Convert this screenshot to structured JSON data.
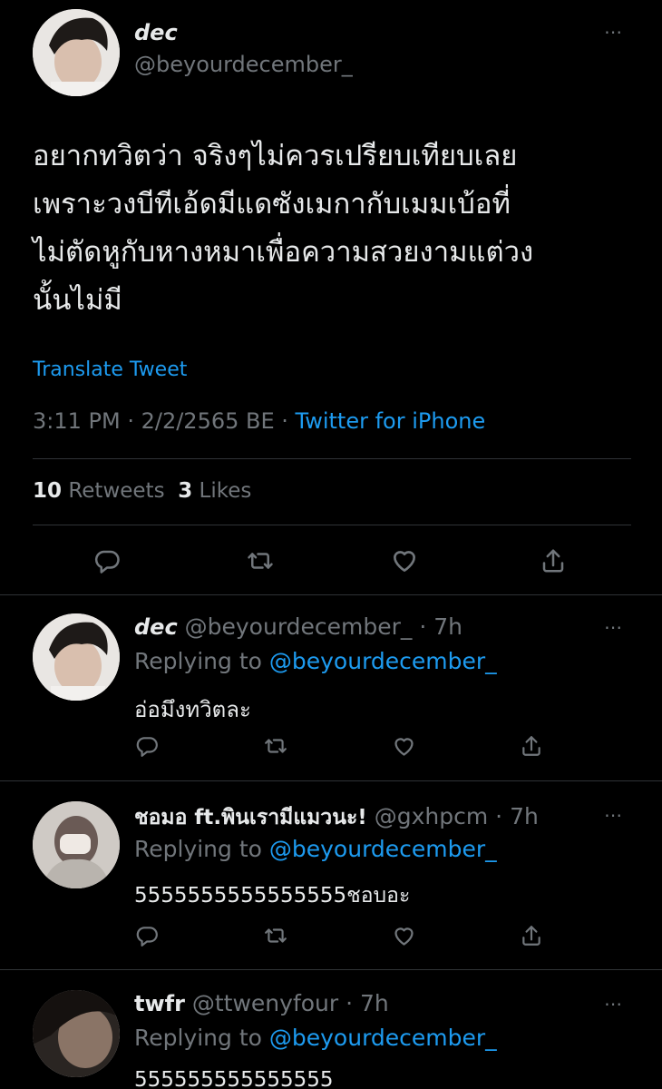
{
  "main_tweet": {
    "display_name": "dec",
    "handle": "@beyourdecember_",
    "more_icon": "⋯",
    "text_lines": [
      "อยากทวิตว่า จริงๆไม่ควรเปรียบเทียบเลย",
      "เพราะวงบีทีเอ้ดมีแดซังเมกากับเมมเบ้อที่",
      "ไม่ตัดหูกับหางหมาเพื่อความสวยงามแต่วง",
      "นั้นไม่มี"
    ],
    "translate_label": "Translate Tweet",
    "timestamp": "3:11 PM · 2/2/2565 BE · ",
    "source": "Twitter for iPhone",
    "retweets_count": "10",
    "retweets_label": "Retweets",
    "likes_count": "3",
    "likes_label": "Likes"
  },
  "replies": [
    {
      "display_name": "dec",
      "handle_time": "@beyourdecember_ · 7h",
      "replying_prefix": "Replying to ",
      "replying_to": "@beyourdecember_",
      "text": "อ่อมึงทวิตละ"
    },
    {
      "display_name": "ชอมอ ft.พินเรามีแมวนะ!",
      "handle_time": "@gxhpcm · 7h",
      "replying_prefix": "Replying to ",
      "replying_to": "@beyourdecember_",
      "text": "5555555555555555ชอบอะ"
    },
    {
      "display_name": "twfr",
      "handle_time": "@ttwenyfour · 7h",
      "replying_prefix": "Replying to ",
      "replying_to": "@beyourdecember_",
      "text": "555555555555555"
    }
  ],
  "icons": {
    "reply": "reply-icon",
    "retweet": "retweet-icon",
    "like": "heart-icon",
    "share": "share-icon",
    "more": "more-icon"
  },
  "colors": {
    "background": "#000000",
    "text": "#e7e9ea",
    "secondary": "#71767b",
    "link": "#1d9bf0",
    "divider": "#2f3336"
  }
}
